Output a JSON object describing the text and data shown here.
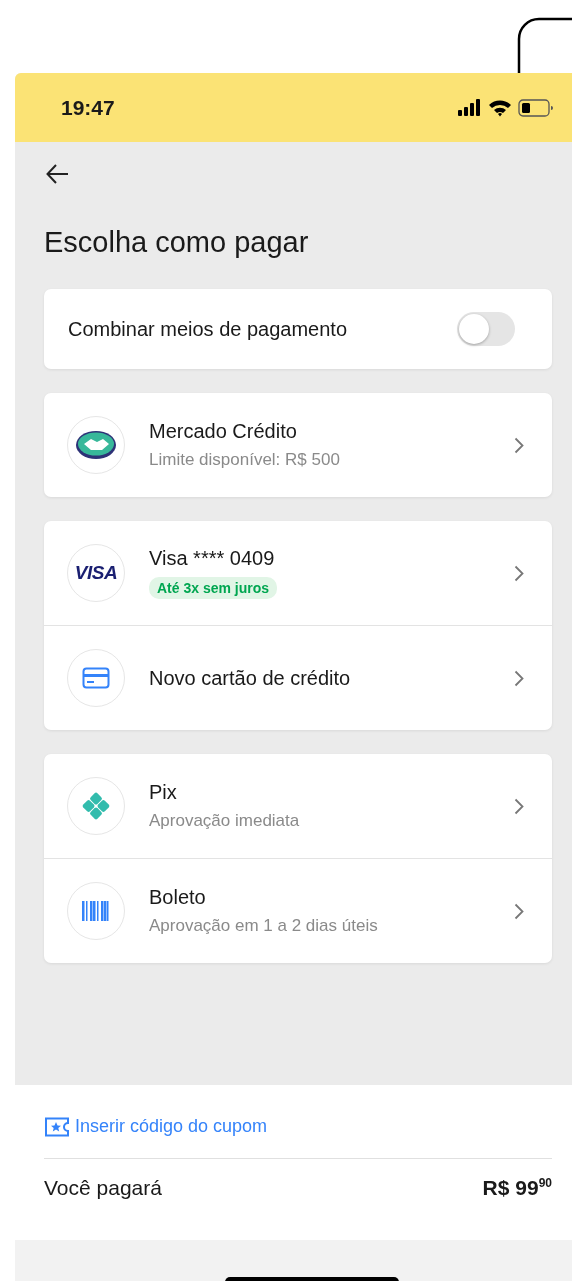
{
  "status_bar": {
    "time": "19:47"
  },
  "title": "Escolha como pagar",
  "combine": {
    "label": "Combinar meios de pagamento",
    "on": false
  },
  "groups": [
    {
      "items": [
        {
          "kind": "mercado",
          "title": "Mercado Crédito",
          "subtitle": "Limite disponível: R$ 500"
        }
      ]
    },
    {
      "items": [
        {
          "kind": "visa",
          "logo": "VISA",
          "title": "Visa **** 0409",
          "badge": "Até 3x sem juros"
        },
        {
          "kind": "card",
          "title": "Novo cartão de crédito"
        }
      ]
    },
    {
      "items": [
        {
          "kind": "pix",
          "title": "Pix",
          "subtitle": "Aprovação imediata"
        },
        {
          "kind": "boleto",
          "title": "Boleto",
          "subtitle": "Aprovação em 1 a 2 dias úteis"
        }
      ]
    }
  ],
  "coupon": "Inserir código do cupom",
  "total": {
    "label": "Você pagará",
    "amount": "R$ 99$^{90}$"
  }
}
